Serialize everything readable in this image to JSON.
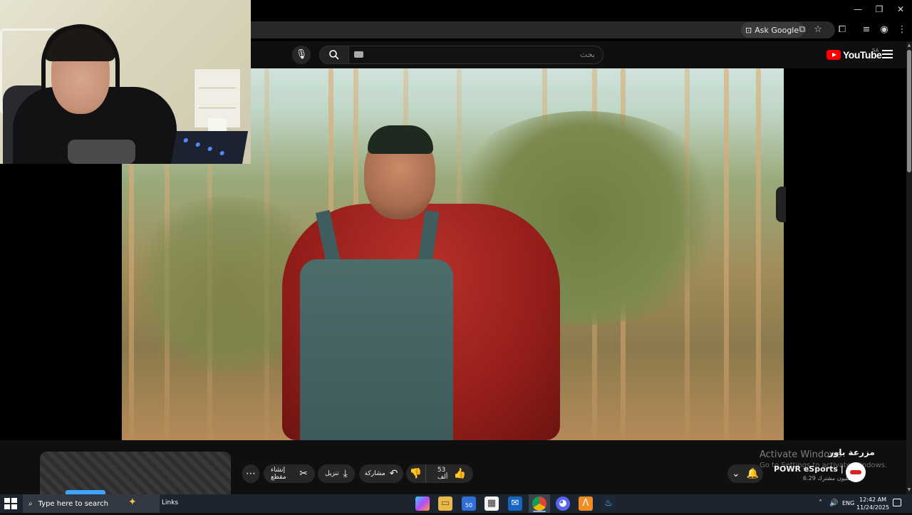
{
  "browser": {
    "ask_google_label": "Ask Google",
    "window_controls": {
      "minimize": "—",
      "restore": "❐",
      "close": "✕"
    }
  },
  "youtube": {
    "search_placeholder": "بحث",
    "logo_text": "YouTube",
    "region": "SA"
  },
  "video": {
    "title": "مزرعة باور",
    "channel_name": "POWR eSports | باور",
    "subscribers": "6.29 مليون مشترك",
    "likes": "53 ألف",
    "actions": {
      "share": "مشاركة",
      "download": "تنزيل",
      "clip": "إنشاء مقطع",
      "more": "⋯"
    }
  },
  "overlay_watermark": {
    "line1": "Activate Windows",
    "line2": "Go to Settings to activate Windows."
  },
  "taskbar": {
    "search_placeholder": "Type here to search",
    "links_label": "Links",
    "mail_badge": "50",
    "language": "ENG",
    "time": "12:42 AM",
    "date": "11/24/2025"
  },
  "colors": {
    "youtube_red": "#ff0000",
    "page_bg": "#0f0f0f",
    "pill_bg": "#272727",
    "taskbar_bg": "#1c2430"
  }
}
